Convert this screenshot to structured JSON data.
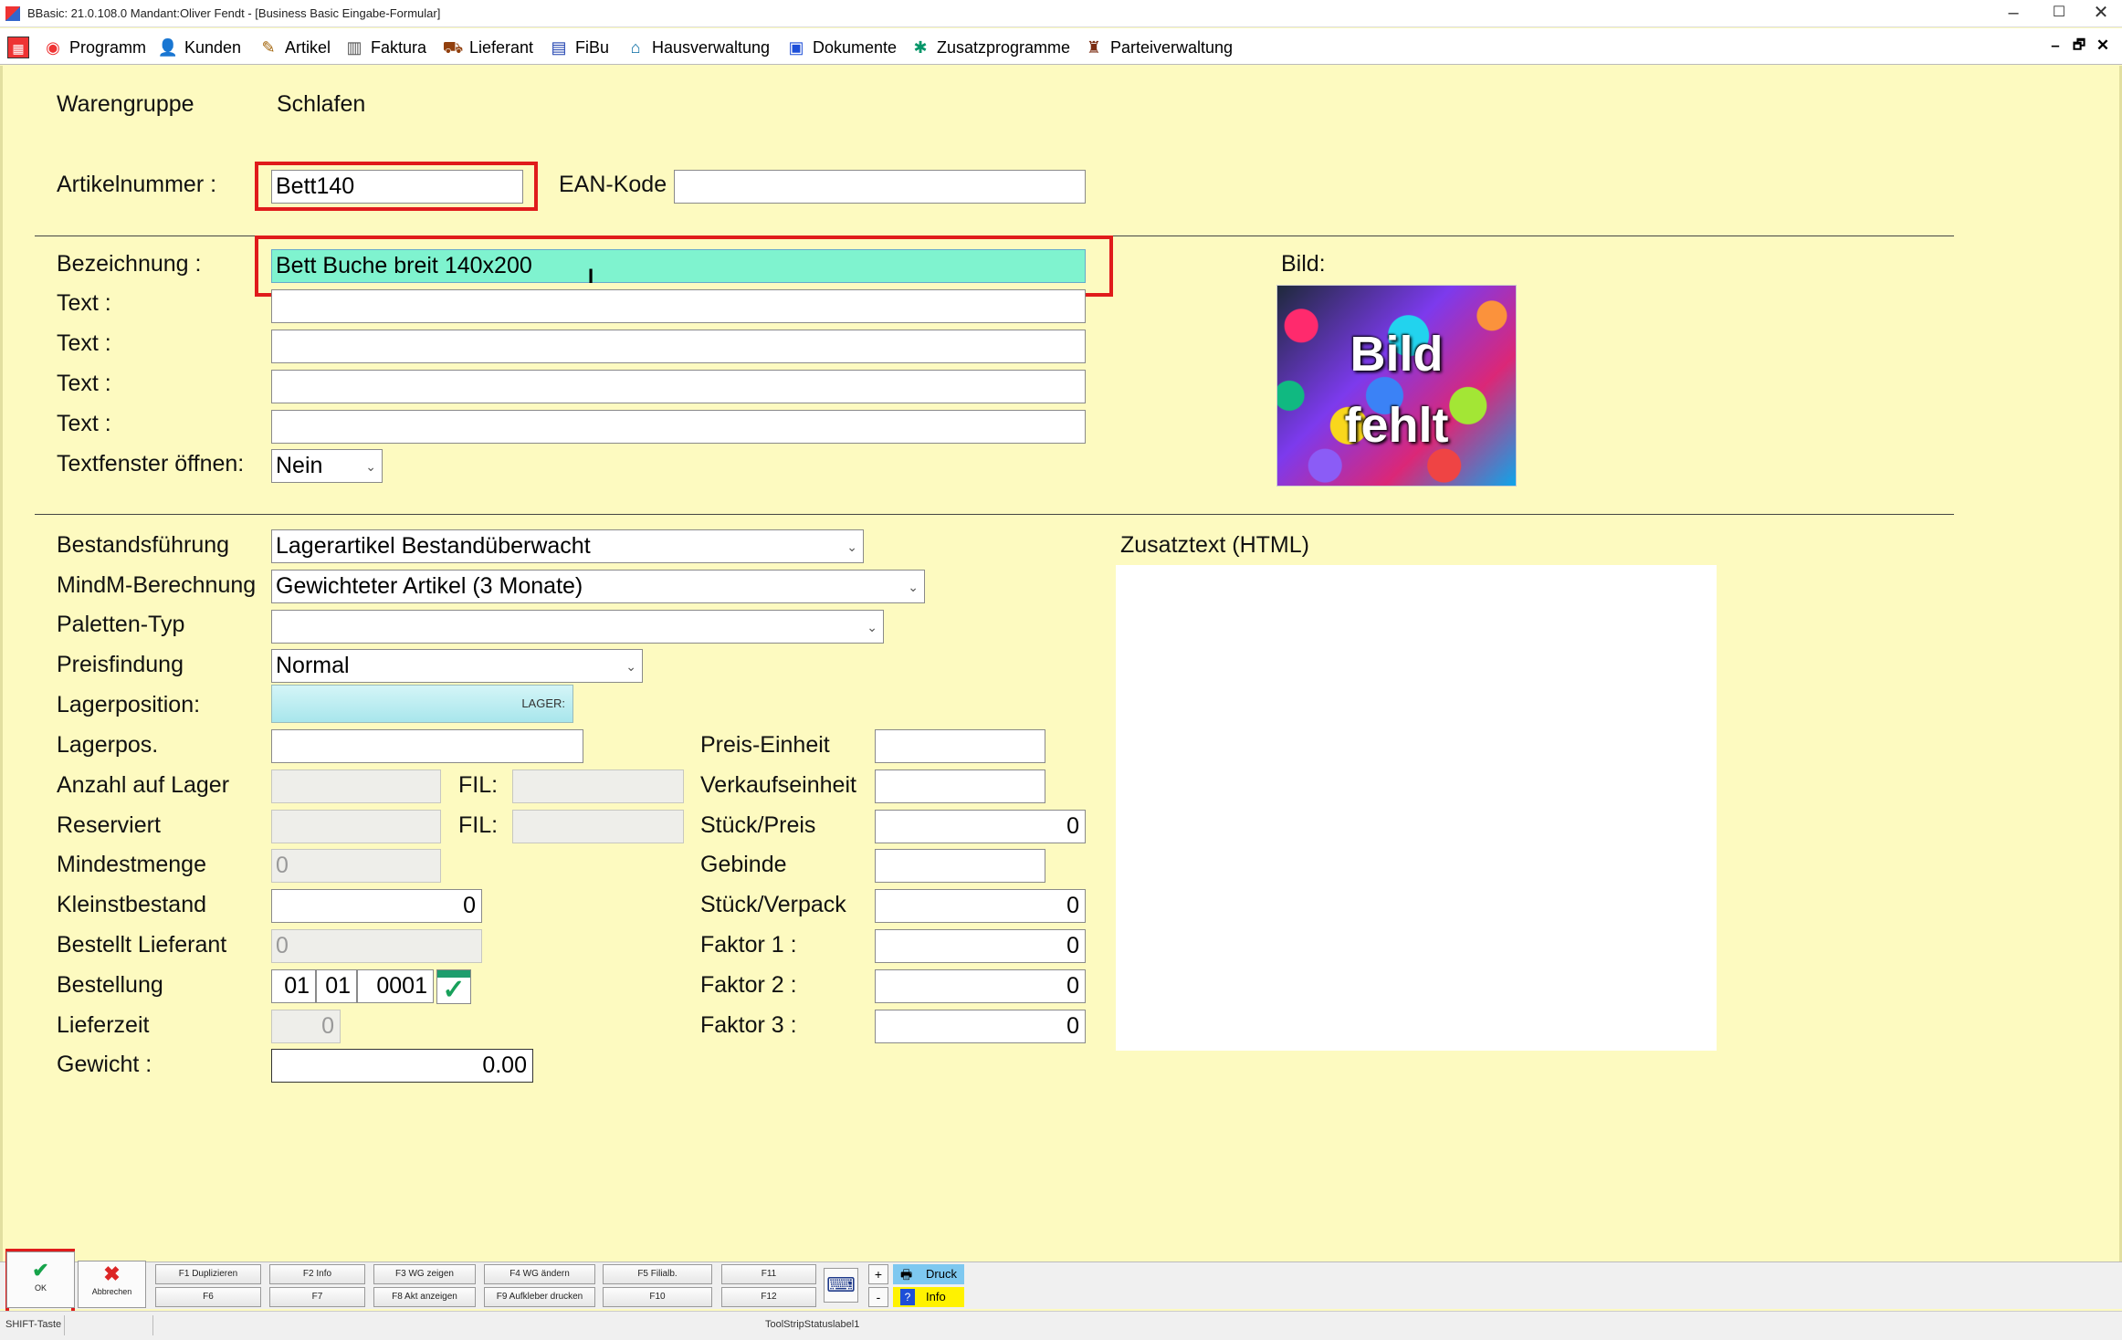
{
  "window": {
    "title": "BBasic: 21.0.108.0 Mandant:Oliver Fendt - [Business Basic Eingabe-Formular]",
    "controls": [
      "–",
      "☐",
      "✕"
    ]
  },
  "menu": {
    "items": [
      {
        "label": "Programm",
        "icon": "programm-icon"
      },
      {
        "label": "Kunden",
        "icon": "kunden-icon"
      },
      {
        "label": "Artikel",
        "icon": "artikel-icon"
      },
      {
        "label": "Faktura",
        "icon": "faktura-icon"
      },
      {
        "label": "Lieferant",
        "icon": "lieferant-icon"
      },
      {
        "label": "FiBu",
        "icon": "fibu-icon"
      },
      {
        "label": "Hausverwaltung",
        "icon": "hausverwaltung-icon"
      },
      {
        "label": "Dokumente",
        "icon": "dokumente-icon"
      },
      {
        "label": "Zusatzprogramme",
        "icon": "zusatzprogramme-icon"
      },
      {
        "label": "Parteiverwaltung",
        "icon": "parteiverwaltung-icon"
      }
    ],
    "mdi_controls": [
      "–",
      "🗗",
      "✕"
    ]
  },
  "form": {
    "warengruppe_label": "Warengruppe",
    "warengruppe_value": "Schlafen",
    "artikelnummer_label": "Artikelnummer :",
    "artikelnummer_value": "Bett140",
    "ean_label": "EAN-Kode",
    "ean_value": "",
    "bezeichnung_label": "Bezeichnung :",
    "bezeichnung_value": "Bett Buche breit 140x200",
    "text_label": "Text :",
    "text_values": [
      "",
      "",
      "",
      ""
    ],
    "textfenster_label": "Textfenster öffnen:",
    "textfenster_value": "Nein",
    "bild_label": "Bild:",
    "bild_text_1": "Bild",
    "bild_text_2": "fehlt",
    "zusatztext_label": "Zusatztext (HTML)",
    "bestandsfuehrung_label": "Bestandsführung",
    "bestandsfuehrung_value": "Lagerartikel Bestandüberwacht",
    "mindm_label": "MindM-Berechnung",
    "mindm_value": "Gewichteter Artikel (3 Monate)",
    "paletten_label": "Paletten-Typ",
    "paletten_value": "",
    "preisfindung_label": "Preisfindung",
    "preisfindung_value": "Normal",
    "lagerposition_label": "Lagerposition:",
    "lagerposition_button": "LAGER:",
    "lagerpos_label": "Lagerpos.",
    "lagerpos_value": "",
    "anzahl_label": "Anzahl auf Lager",
    "anzahl_value": "",
    "fil_label": "FIL:",
    "anzahl_fil_value": "",
    "reserviert_label": "Reserviert",
    "reserviert_value": "",
    "reserviert_fil_value": "",
    "mindestmenge_label": "Mindestmenge",
    "mindestmenge_value": "0",
    "kleinstbestand_label": "Kleinstbestand",
    "kleinstbestand_value": "0",
    "bestellt_label": "Bestellt Lieferant",
    "bestellt_value": "0",
    "bestellung_label": "Bestellung",
    "bestellung_day": "01",
    "bestellung_month": "01",
    "bestellung_year": "0001",
    "lieferzeit_label": "Lieferzeit",
    "lieferzeit_value": "0",
    "gewicht_label": "Gewicht :",
    "gewicht_value": "0.00",
    "preiseinheit_label": "Preis-Einheit",
    "preiseinheit_value": "",
    "verkaufseinheit_label": "Verkaufseinheit",
    "verkaufseinheit_value": "",
    "stueckpreis_label": "Stück/Preis",
    "stueckpreis_value": "0",
    "gebinde_label": "Gebinde",
    "gebinde_value": "",
    "stueckverpack_label": "Stück/Verpack",
    "stueckverpack_value": "0",
    "faktor1_label": "Faktor 1 :",
    "faktor1_value": "0",
    "faktor2_label": "Faktor 2 :",
    "faktor2_value": "0",
    "faktor3_label": "Faktor 3 :",
    "faktor3_value": "0"
  },
  "toolbar": {
    "ok_label": "OK",
    "abbrechen_label": "Abbrechen",
    "f1": "F1 Duplizieren",
    "f2": "F2 Info",
    "f3": "F3 WG zeigen",
    "f4": "F4 WG ändern",
    "f5": "F5 Filialb.",
    "f6": "F6",
    "f7": "F7",
    "f8": "F8 Akt anzeigen",
    "f9": "F9 Aufkleber drucken",
    "f10": "F10",
    "f11": "F11",
    "f12": "F12",
    "plus": "+",
    "minus": "-",
    "druck": "Druck",
    "info": "Info"
  },
  "status": {
    "shift": "SHIFT-Taste",
    "label": "ToolStripStatuslabel1"
  },
  "colors": {
    "form_bg": "#fdfac0",
    "highlight": "#7ff3cf",
    "red_frame": "#e01b1b",
    "druck_bg": "#7ec8f0",
    "info_bg": "#fff200"
  }
}
